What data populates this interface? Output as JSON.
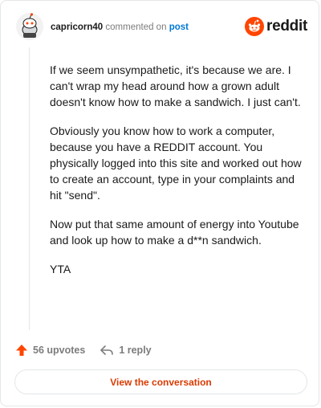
{
  "header": {
    "username": "capricorn40",
    "verb": "commented on",
    "post_link": "post",
    "brand": "reddit"
  },
  "comment": {
    "paragraphs": [
      "If we seem unsympathetic, it's because we are. I can't wrap my head around how a grown adult doesn't know how to make a sandwich. I just can't.",
      "Obviously you know how to work a computer, because you have a REDDIT account. You physically logged into this site and worked out how to create an account, type in your complaints and hit \"send\".",
      "Now put that same amount of energy into Youtube and look up how to make a d**n sandwich.",
      "YTA"
    ]
  },
  "actions": {
    "upvotes": "56 upvotes",
    "replies": "1 reply"
  },
  "footer": {
    "view_button": "View the conversation"
  },
  "colors": {
    "reddit_orange": "#ff4500",
    "link_blue": "#0079d3",
    "button_text": "#d93a00"
  },
  "icons": [
    "avatar-snoo-icon",
    "reddit-logo-icon",
    "upvote-arrow-icon",
    "reply-arrow-icon"
  ]
}
